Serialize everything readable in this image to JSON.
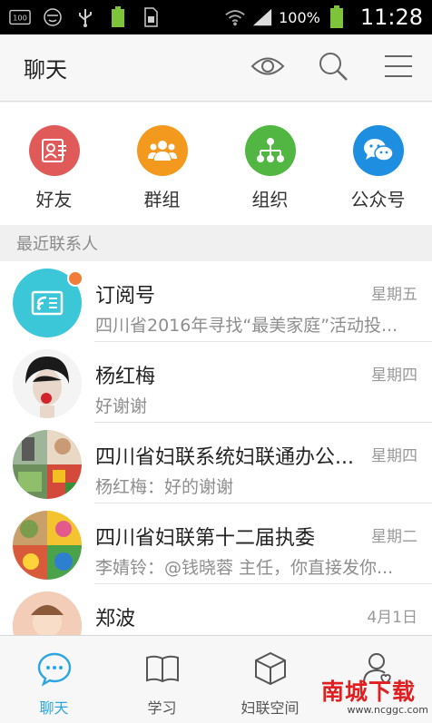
{
  "statusbar": {
    "battery_percent": "100%",
    "time": "11:28"
  },
  "header": {
    "title": "聊天",
    "icons": [
      "eye-icon",
      "search-icon",
      "menu-icon"
    ]
  },
  "quick_actions": [
    {
      "label": "好友",
      "icon": "contact-card-icon",
      "color": "#e05a5a"
    },
    {
      "label": "群组",
      "icon": "group-icon",
      "color": "#f39a1e"
    },
    {
      "label": "组织",
      "icon": "org-chart-icon",
      "color": "#52b742"
    },
    {
      "label": "公众号",
      "icon": "wechat-icon",
      "color": "#1e8fe0"
    }
  ],
  "section": {
    "title": "最近联系人"
  },
  "chats": [
    {
      "name": "订阅号",
      "time": "星期五",
      "message": "四川省2016年寻找“最美家庭”活动投..."
    },
    {
      "name": "杨红梅",
      "time": "星期四",
      "message": "好谢谢"
    },
    {
      "name": "四川省妇联系统妇联通办公...",
      "time": "星期四",
      "message": "杨红梅：好的谢谢"
    },
    {
      "name": "四川省妇联第十二届执委",
      "time": "星期二",
      "message": "李婧铃：@钱晓蓉 主任，你直接发你..."
    },
    {
      "name": "郑波",
      "time": "4月1日",
      "message": ""
    }
  ],
  "bottom_nav": [
    {
      "label": "聊天",
      "icon": "chat-bubble-icon",
      "active": true
    },
    {
      "label": "学习",
      "icon": "book-icon",
      "active": false
    },
    {
      "label": "妇联空间",
      "icon": "cube-icon",
      "active": false
    },
    {
      "label": "",
      "icon": "profile-icon",
      "active": false
    }
  ],
  "watermark": {
    "cn": "南城下载",
    "url": "www.ncggc.com"
  },
  "colors": {
    "accent": "#2ba6e3",
    "subscription": "#3cc7d9",
    "badge": "#f07d3a"
  }
}
